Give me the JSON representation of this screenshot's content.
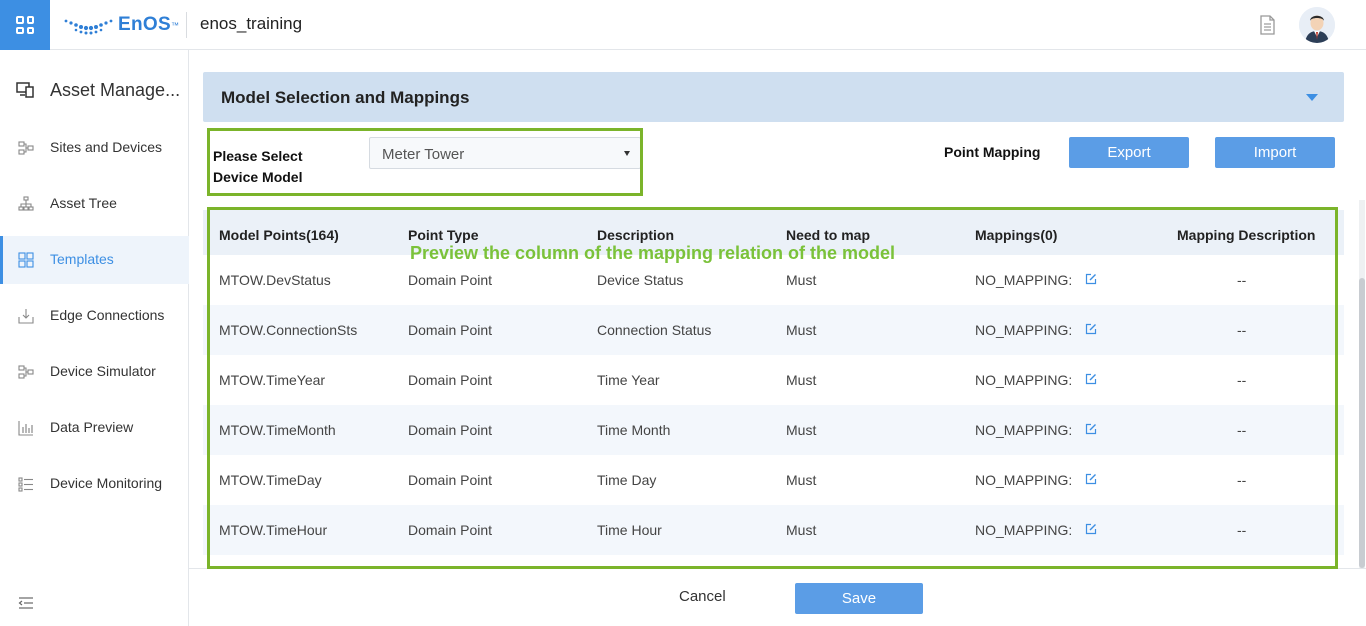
{
  "header": {
    "logo_text": "EnOS",
    "logo_tm": "™",
    "org_name": "enos_training"
  },
  "sidebar": {
    "title": "Asset Manage...",
    "items": [
      {
        "label": "Sites and Devices",
        "icon": "sites-devices-icon",
        "active": false
      },
      {
        "label": "Asset Tree",
        "icon": "asset-tree-icon",
        "active": false
      },
      {
        "label": "Templates",
        "icon": "templates-icon",
        "active": true
      },
      {
        "label": "Edge Connections",
        "icon": "edge-connections-icon",
        "active": false
      },
      {
        "label": "Device Simulator",
        "icon": "device-simulator-icon",
        "active": false
      },
      {
        "label": "Data Preview",
        "icon": "data-preview-icon",
        "active": false
      },
      {
        "label": "Device Monitoring",
        "icon": "device-monitoring-icon",
        "active": false
      }
    ]
  },
  "section": {
    "title": "Model Selection and Mappings"
  },
  "model_select": {
    "label": "Please Select Device Model",
    "value": "Meter Tower"
  },
  "point_mapping": {
    "label": "Point Mapping",
    "export_label": "Export",
    "import_label": "Import"
  },
  "table": {
    "headers": [
      "Model Points(164)",
      "Point Type",
      "Description",
      "Need to map",
      "Mappings(0)",
      "Mapping Description"
    ],
    "rows": [
      [
        "MTOW.DevStatus",
        "Domain Point",
        "Device Status",
        "Must",
        "NO_MAPPING:",
        "--"
      ],
      [
        "MTOW.ConnectionSts",
        "Domain Point",
        "Connection Status",
        "Must",
        "NO_MAPPING:",
        "--"
      ],
      [
        "MTOW.TimeYear",
        "Domain Point",
        "Time Year",
        "Must",
        "NO_MAPPING:",
        "--"
      ],
      [
        "MTOW.TimeMonth",
        "Domain Point",
        "Time Month",
        "Must",
        "NO_MAPPING:",
        "--"
      ],
      [
        "MTOW.TimeDay",
        "Domain Point",
        "Time Day",
        "Must",
        "NO_MAPPING:",
        "--"
      ],
      [
        "MTOW.TimeHour",
        "Domain Point",
        "Time Hour",
        "Must",
        "NO_MAPPING:",
        "--"
      ]
    ]
  },
  "annotation": "Preview the column of the mapping relation of  the model",
  "footer": {
    "cancel_label": "Cancel",
    "save_label": "Save"
  },
  "colors": {
    "brand_blue": "#3d8fe3",
    "button_blue": "#5b9de6",
    "highlight_green": "#7bb42a",
    "section_header_bg": "#cfdff0"
  }
}
